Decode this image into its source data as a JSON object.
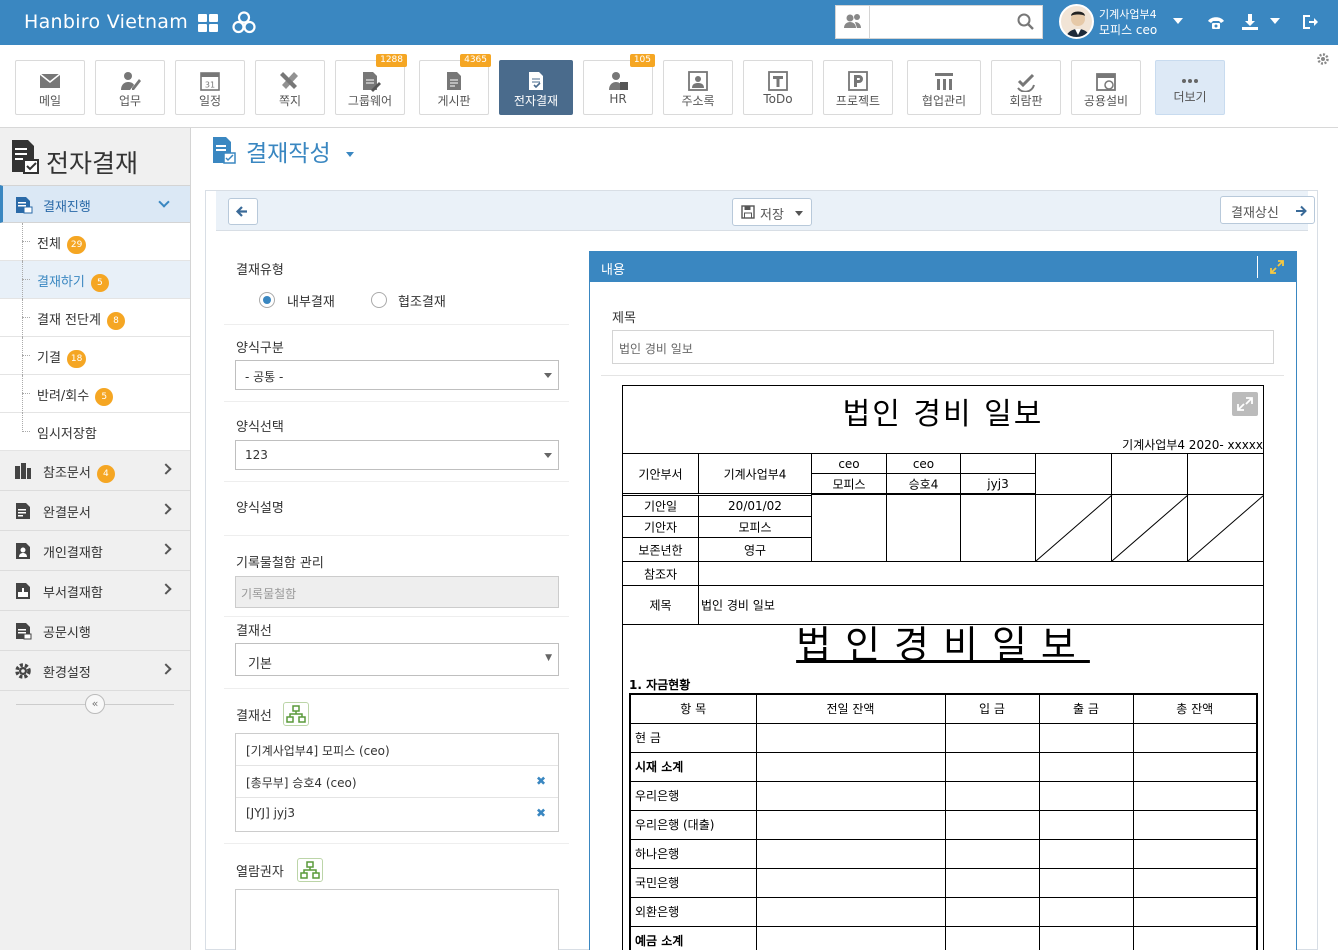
{
  "topbar": {
    "brand": "Hanbiro Vietnam",
    "search_placeholder": "",
    "user_dept": "기계사업부4",
    "user_name": "모피스 ceo"
  },
  "apps": [
    {
      "label": "메일",
      "icon": "mail-icon"
    },
    {
      "label": "업무",
      "icon": "task-icon"
    },
    {
      "label": "일정",
      "icon": "calendar-icon",
      "date": "31"
    },
    {
      "label": "쪽지",
      "icon": "memo-icon"
    },
    {
      "label": "그룹웨어",
      "icon": "groupware-icon",
      "badge": "1288"
    },
    {
      "label": "게시판",
      "icon": "board-icon",
      "badge": "4365"
    },
    {
      "label": "전자결재",
      "icon": "approval-icon"
    },
    {
      "label": "HR",
      "icon": "hr-icon",
      "badge": "105"
    },
    {
      "label": "주소록",
      "icon": "contacts-icon"
    },
    {
      "label": "ToDo",
      "icon": "todo-icon"
    },
    {
      "label": "프로젝트",
      "icon": "project-icon"
    },
    {
      "label": "협업관리",
      "icon": "collab-icon"
    },
    {
      "label": "회람판",
      "icon": "circular-icon"
    },
    {
      "label": "공용설비",
      "icon": "equipment-icon"
    },
    {
      "label": "더보기",
      "icon": "more-icon"
    }
  ],
  "colors": {
    "primary": "#3a87c1",
    "badge": "#f5a623",
    "active_app": "#4a6b8c"
  },
  "sidebar": {
    "title": "전자결재",
    "active_section": "결재진행",
    "subitems": [
      {
        "label": "전체",
        "count": "29"
      },
      {
        "label": "결재하기",
        "count": "5"
      },
      {
        "label": "결재 전단계",
        "count": "8"
      },
      {
        "label": "기결",
        "count": "18"
      },
      {
        "label": "반려/회수",
        "count": "5"
      },
      {
        "label": "임시저장함",
        "count": ""
      }
    ],
    "sections": [
      {
        "label": "참조문서",
        "count": "4"
      },
      {
        "label": "완결문서",
        "count": ""
      },
      {
        "label": "개인결재함",
        "count": ""
      },
      {
        "label": "부서결재함",
        "count": ""
      },
      {
        "label": "공문시행",
        "count": ""
      },
      {
        "label": "환경설정",
        "count": ""
      }
    ]
  },
  "main": {
    "title": "결재작성",
    "save_label": "저장",
    "send_label": "결재상신",
    "approval_type_label": "결재유형",
    "radio_internal": "내부결재",
    "radio_coop": "협조결재",
    "form_category_label": "양식구분",
    "form_category_value": "- 공통 -",
    "form_select_label": "양식선택",
    "form_select_value": "123",
    "form_desc_label": "양식설명",
    "records_label": "기록물철함 관리",
    "records_placeholder": "기록물철함",
    "line_label": "결재선",
    "line_value": "기본",
    "approvers_label": "결재선",
    "approvers": [
      {
        "text": "[기계사업부4] 모피스 (ceo)",
        "removable": false
      },
      {
        "text": "[총무부] 승호4 (ceo)",
        "removable": true
      },
      {
        "text": "[JYJ] jyj3",
        "removable": true
      }
    ],
    "viewer_label": "열람권자"
  },
  "content": {
    "header": "내용",
    "subject_label": "제목",
    "subject_value": "법인 경비 일보",
    "doc_title": "법인 경비 일보",
    "doc_no": "기계사업부4 2020- xxxxx",
    "labels": {
      "dept": "기안부서",
      "dept_val": "기계사업부4",
      "date": "기안일",
      "date_val": "20/01/02",
      "drafter": "기안자",
      "drafter_val": "모피스",
      "retention": "보존년한",
      "retention_val": "영구",
      "ref": "참조자",
      "subject": "제목",
      "subject_val": "법인 경비 일보"
    },
    "approval_cols": [
      {
        "title": "ceo",
        "name": "모피스"
      },
      {
        "title": "ceo",
        "name": "승호4"
      },
      {
        "title": "",
        "name": "jyj3"
      }
    ],
    "big_title": "법인경비일보",
    "section_title": "1. 자금현황",
    "fund_headers": [
      "항 목",
      "전일 잔액",
      "입 금",
      "출 금",
      "총 잔액"
    ],
    "fund_rows": [
      {
        "label": "현 금",
        "bold": false
      },
      {
        "label": "시재 소계",
        "bold": true
      },
      {
        "label": "우리은행",
        "bold": false
      },
      {
        "label": "우리은행 (대출)",
        "bold": false
      },
      {
        "label": "하나은행",
        "bold": false
      },
      {
        "label": "국민은행",
        "bold": false
      },
      {
        "label": "외환은행",
        "bold": false
      },
      {
        "label": "예금 소계",
        "bold": true
      }
    ]
  }
}
